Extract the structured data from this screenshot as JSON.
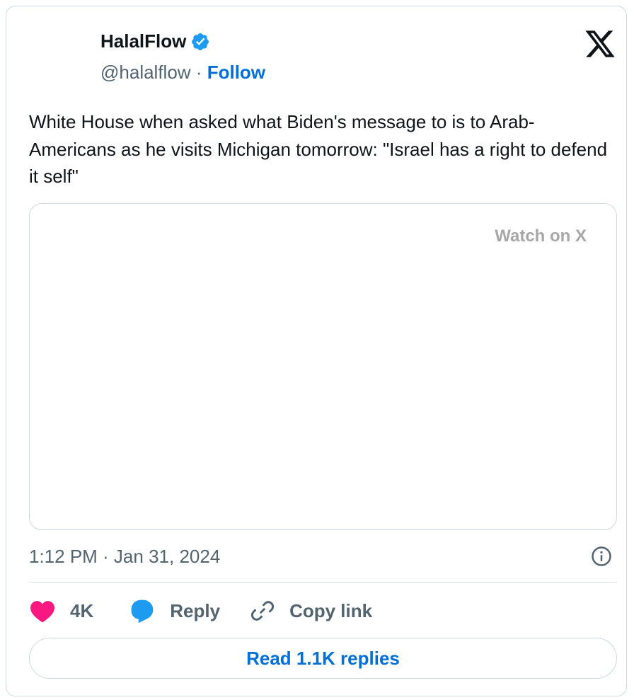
{
  "author": {
    "name": "HalalFlow",
    "handle": "@halalflow",
    "separator": "·",
    "follow_label": "Follow",
    "verified_icon": "verified-badge-icon"
  },
  "tweet": {
    "text": "White House when asked what Biden's message to is to Arab-Americans as he visits Michigan tomorrow: \"Israel has a right to defend it self\""
  },
  "media": {
    "watch_label": "Watch on X"
  },
  "meta": {
    "timestamp": "1:12 PM · Jan 31, 2024"
  },
  "actions": {
    "like_count": "4K",
    "reply_label": "Reply",
    "copy_link_label": "Copy link"
  },
  "footer": {
    "read_replies_label": "Read 1.1K replies"
  },
  "colors": {
    "brand_blue": "#006fd6",
    "verified_blue": "#1d9bf0",
    "like_pink": "#f91880",
    "secondary_text": "#536471",
    "border": "#cfd9de"
  }
}
